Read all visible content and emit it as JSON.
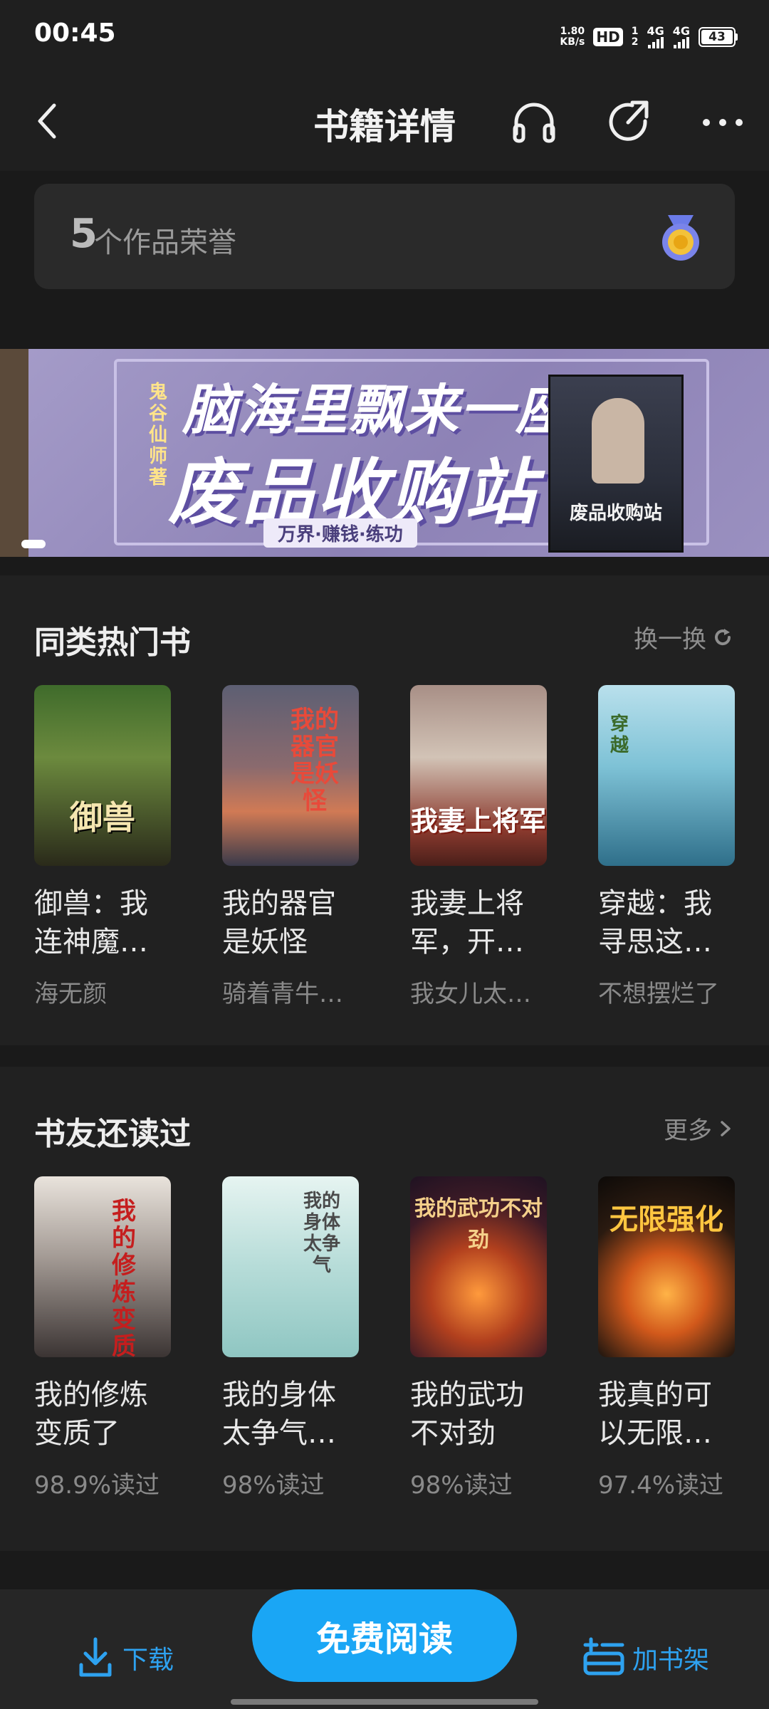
{
  "status": {
    "time": "00:45",
    "net_speed_value": "1.80",
    "net_speed_unit": "KB/s",
    "hd": "HD",
    "sim1": "1",
    "sim2": "2",
    "signal_label_1": "4G",
    "signal_label_2": "4G",
    "battery": "43"
  },
  "nav": {
    "title": "书籍详情"
  },
  "honor": {
    "count": "5",
    "text": "个作品荣誉"
  },
  "banner": {
    "author": "鬼谷仙师著",
    "line1": "脑海里飘来一座",
    "line2": "废品收购站",
    "tag": "万界·赚钱·练功",
    "book_title": "废品收购站"
  },
  "similar": {
    "title": "同类热门书",
    "action": "换一换",
    "books": [
      {
        "title": "御兽：我连神魔…",
        "author": "海无颜",
        "cover_text": "御兽"
      },
      {
        "title": "我的器官是妖怪",
        "author": "骑着青牛…",
        "cover_text": "我的器官是妖怪"
      },
      {
        "title": "我妻上将军，开…",
        "author": "我女儿太…",
        "cover_text": "我妻上将军"
      },
      {
        "title": "穿越：我寻思这…",
        "author": "不想摆烂了",
        "cover_text": "穿越"
      }
    ]
  },
  "also_read": {
    "title": "书友还读过",
    "action": "更多",
    "books": [
      {
        "title": "我的修炼变质了",
        "stat": "98.9%读过",
        "cover_text": "我的修炼变质了"
      },
      {
        "title": "我的身体太争气…",
        "stat": "98%读过",
        "cover_text": "我的身体太争气"
      },
      {
        "title": "我的武功不对劲",
        "stat": "98%读过",
        "cover_text": "我的武功不对劲"
      },
      {
        "title": "我真的可以无限…",
        "stat": "97.4%读过",
        "cover_text": "无限强化"
      }
    ]
  },
  "bottom": {
    "download": "下载",
    "read": "免费阅读",
    "shelf": "加书架"
  }
}
